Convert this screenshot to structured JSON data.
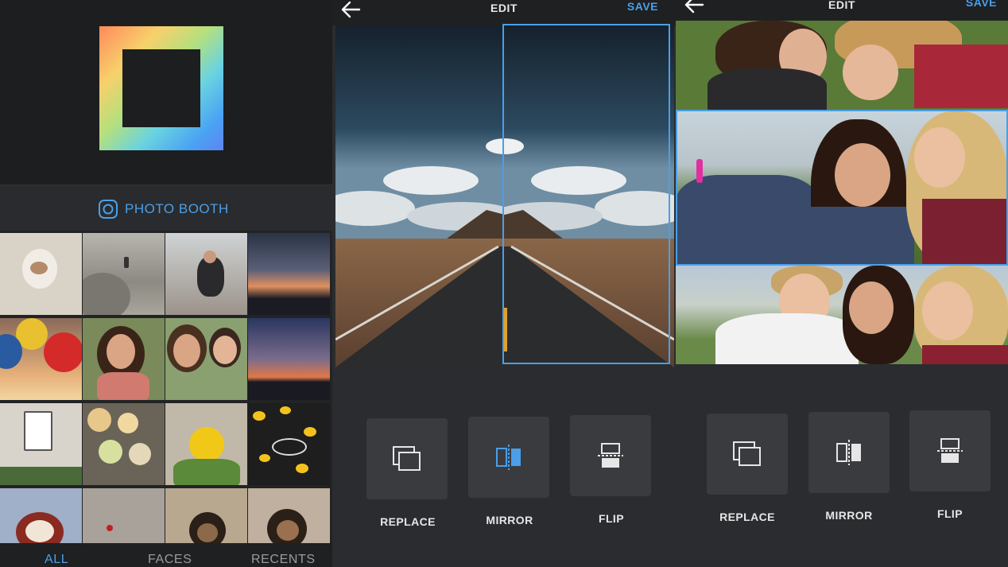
{
  "panel1": {
    "section_label": "PHOTO BOOTH",
    "tabs": [
      {
        "label": "ALL",
        "active": true
      },
      {
        "label": "FACES",
        "active": false
      },
      {
        "label": "RECENTS",
        "active": false
      }
    ]
  },
  "panel2": {
    "nav": {
      "title": "EDIT",
      "save_label": "SAVE"
    },
    "tools": [
      {
        "label": "REPLACE",
        "icon": "replace-icon",
        "active": false
      },
      {
        "label": "MIRROR",
        "icon": "mirror-icon",
        "active": true
      },
      {
        "label": "FLIP",
        "icon": "flip-icon",
        "active": false
      }
    ]
  },
  "panel3": {
    "nav": {
      "title": "EDIT",
      "save_label": "SAVE"
    },
    "tools": [
      {
        "label": "REPLACE",
        "icon": "replace-icon",
        "active": false
      },
      {
        "label": "MIRROR",
        "icon": "mirror-icon",
        "active": false
      },
      {
        "label": "FLIP",
        "icon": "flip-icon",
        "active": false
      }
    ]
  },
  "colors": {
    "accent": "#4a9fe8",
    "background": "#2b2c2f",
    "button": "#3a3b3e",
    "text": "#e6e6e7"
  }
}
